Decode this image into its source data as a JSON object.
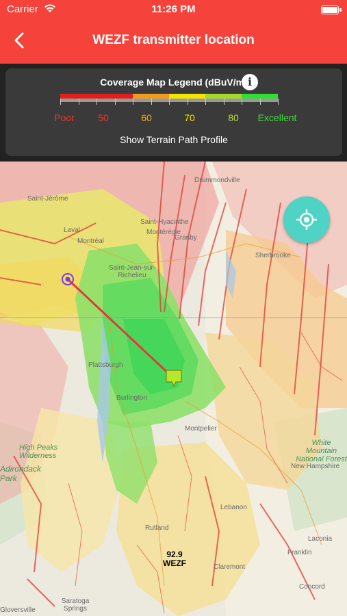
{
  "status_bar": {
    "carrier": "Carrier",
    "time": "11:26 PM"
  },
  "nav": {
    "title": "WEZF transmitter location",
    "back_icon": "chevron-left-icon"
  },
  "legend": {
    "title": "Coverage Map Legend (dBuV/m)",
    "info_icon": "info-icon",
    "info_glyph": "i",
    "scale_labels": [
      {
        "text": "Poor",
        "color": "#e53b2f"
      },
      {
        "text": "50",
        "color": "#e53b2f"
      },
      {
        "text": "60",
        "color": "#f5a623"
      },
      {
        "text": "70",
        "color": "#f4e500"
      },
      {
        "text": "80",
        "color": "#b8e03c"
      },
      {
        "text": "Excellent",
        "color": "#3fdc3a"
      }
    ],
    "scale_colors": [
      "#e0201d",
      "#e0201d",
      "#f19a1c",
      "#f4e500",
      "#a6d82c",
      "#2fe02f"
    ],
    "terrain_link": "Show Terrain Path Profile"
  },
  "map": {
    "station": {
      "frequency": "92.9",
      "call_sign": "WEZF"
    },
    "locate_icon": "crosshair-icon",
    "places": [
      "Drummondville",
      "Saint-Jérôme",
      "Saint-Hyacinthe",
      "Montérégie",
      "Laval",
      "Montréal",
      "Granby",
      "Sherbrooke",
      "Saint-Jean-sur-Richelieu",
      "Plattsburgh",
      "Burlington",
      "Montpelier",
      "White Mountain National Forest",
      "New Hampshire",
      "High Peaks Wilderness",
      "Adirondack Park",
      "Rutland",
      "Lebanon",
      "Laconia",
      "Franklin",
      "Claremont",
      "Concord",
      "Saratoga Springs",
      "Gloversville"
    ]
  }
}
